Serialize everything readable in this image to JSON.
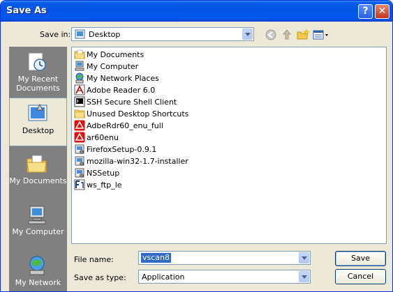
{
  "window": {
    "title": "Save As",
    "help_label": "?",
    "close_label": "✕"
  },
  "save_in": {
    "label": "Save in:",
    "value": "Desktop"
  },
  "places": [
    {
      "label": "My Recent Documents",
      "icon": "recent-documents-icon"
    },
    {
      "label": "Desktop",
      "icon": "desktop-icon",
      "selected": true
    },
    {
      "label": "My Documents",
      "icon": "my-documents-icon"
    },
    {
      "label": "My Computer",
      "icon": "my-computer-icon"
    },
    {
      "label": "My Network",
      "icon": "my-network-icon"
    }
  ],
  "files": [
    {
      "name": "My Documents",
      "icon": "folder-icon"
    },
    {
      "name": "My Computer",
      "icon": "computer-icon"
    },
    {
      "name": "My Network Places",
      "icon": "network-icon"
    },
    {
      "name": "Adobe Reader 6.0",
      "icon": "adobe-reader-icon"
    },
    {
      "name": "SSH Secure Shell Client",
      "icon": "ssh-client-icon"
    },
    {
      "name": "Unused Desktop Shortcuts",
      "icon": "folder-icon"
    },
    {
      "name": "AdbeRdr60_enu_full",
      "icon": "adobe-installer-icon"
    },
    {
      "name": "ar60enu",
      "icon": "adobe-installer-icon"
    },
    {
      "name": "FirefoxSetup-0.9.1",
      "icon": "setup-icon"
    },
    {
      "name": "mozilla-win32-1.7-installer",
      "icon": "setup-icon"
    },
    {
      "name": "NSSetup",
      "icon": "setup-icon"
    },
    {
      "name": "ws_ftp_le",
      "icon": "ftp-icon"
    }
  ],
  "file_name": {
    "label": "File name:",
    "value": "vscan8"
  },
  "save_as_type": {
    "label": "Save as type:",
    "value": "Application"
  },
  "buttons": {
    "save": "Save",
    "cancel": "Cancel"
  }
}
